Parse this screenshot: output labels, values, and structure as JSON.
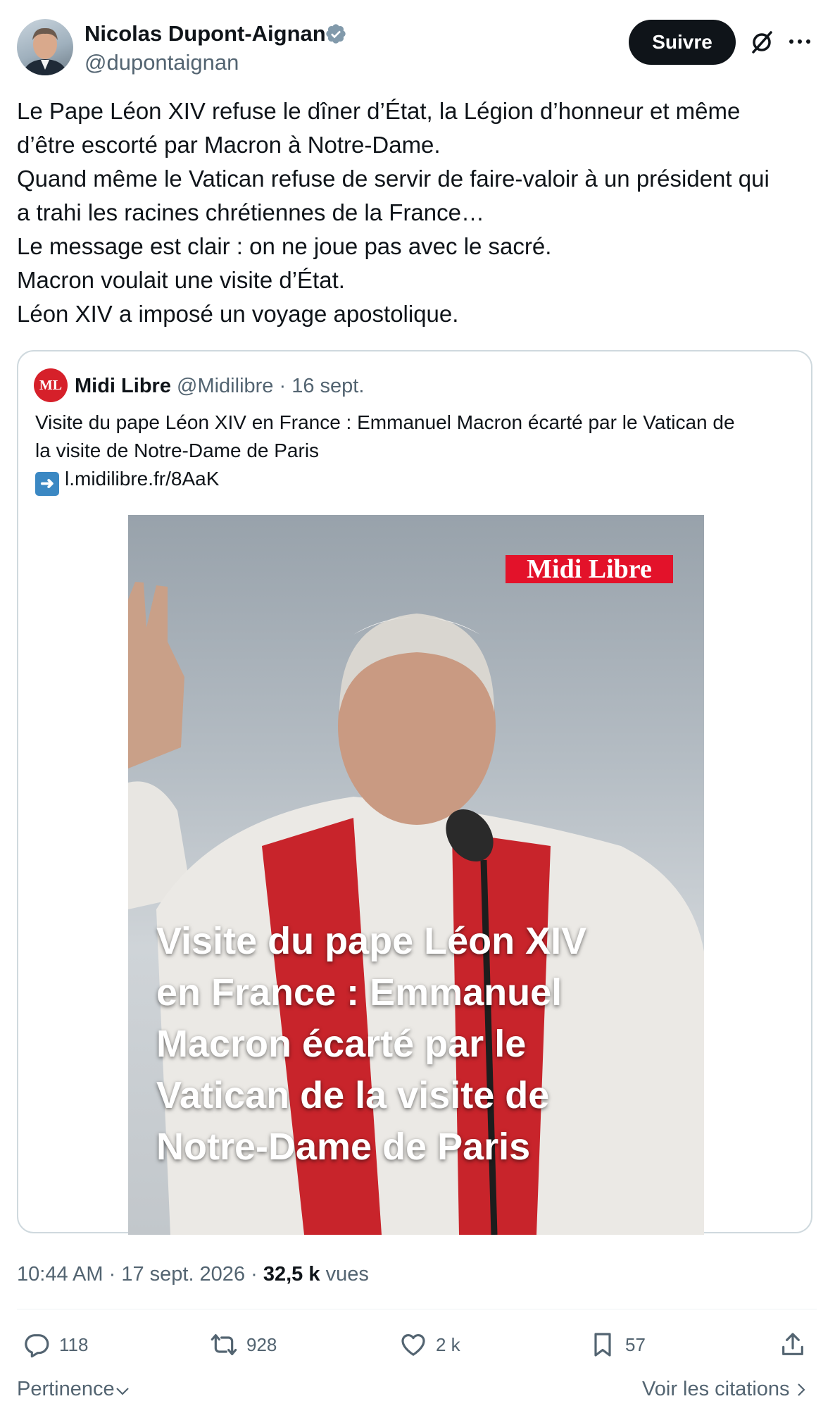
{
  "author": {
    "name": "Nicolas Dupont-Aignan",
    "handle": "@dupontaignan",
    "verified": true
  },
  "follow_button": "Suivre",
  "tweet_lines": [
    "Le Pape Léon XIV refuse le dîner d’État, la Légion d’honneur et même",
    "d’être escorté par Macron à Notre-Dame.",
    "Quand même le Vatican refuse de servir de faire-valoir à un président qui",
    "a trahi les racines chrétiennes de la France…",
    "Le message est clair : on ne joue pas avec le sacré.",
    "Macron voulait une visite d’État.",
    "Léon XIV a imposé un voyage apostolique."
  ],
  "quoted": {
    "logo_text": "ML",
    "name": "Midi Libre",
    "handle": "@Midilibre",
    "separator": " · ",
    "date": "16 sept.",
    "text_lines": [
      "Visite du pape Léon XIV en France : Emmanuel Macron écarté par le Vatican de",
      "la visite de Notre-Dame de Paris"
    ],
    "link": "l.midilibre.fr/8AaK",
    "image": {
      "brand": "Midi Libre",
      "headline_lines": [
        "Visite du pape Léon XIV",
        "en France : Emmanuel",
        "Macron écarté par le",
        "Vatican de la visite de",
        "Notre-Dame de Paris"
      ]
    }
  },
  "meta": {
    "time": "10:44 AM",
    "dot": " · ",
    "date": "17 sept. 2026",
    "views_count": "32,5 k",
    "views_label": "vues"
  },
  "actions": {
    "replies": "118",
    "reposts": "928",
    "likes": "2 k",
    "bookmarks": "57"
  },
  "footer": {
    "sort_label": "Pertinence",
    "quotes_link": "Voir les citations"
  },
  "colors": {
    "text": "#0f1419",
    "secondary": "#536471",
    "verified": "#829aab",
    "brand_red": "#e3122a"
  }
}
